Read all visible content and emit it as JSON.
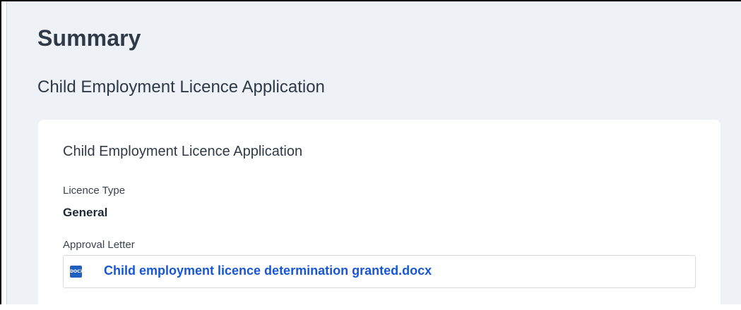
{
  "page": {
    "title": "Summary",
    "subtitle": "Child Employment Licence Application"
  },
  "card": {
    "title": "Child Employment Licence Application",
    "fields": {
      "licence_type_label": "Licence Type",
      "licence_type_value": "General",
      "approval_letter_label": "Approval Letter"
    },
    "attachment": {
      "icon": "docx-file-icon",
      "icon_label": "DOCX",
      "file_name": "Child employment licence determination granted.docx",
      "link_color": "#1757d6"
    }
  },
  "colors": {
    "page_background": "#eef1f6",
    "card_background": "#ffffff",
    "heading_text": "#2f3a48",
    "icon_background": "#1f5fbf"
  }
}
